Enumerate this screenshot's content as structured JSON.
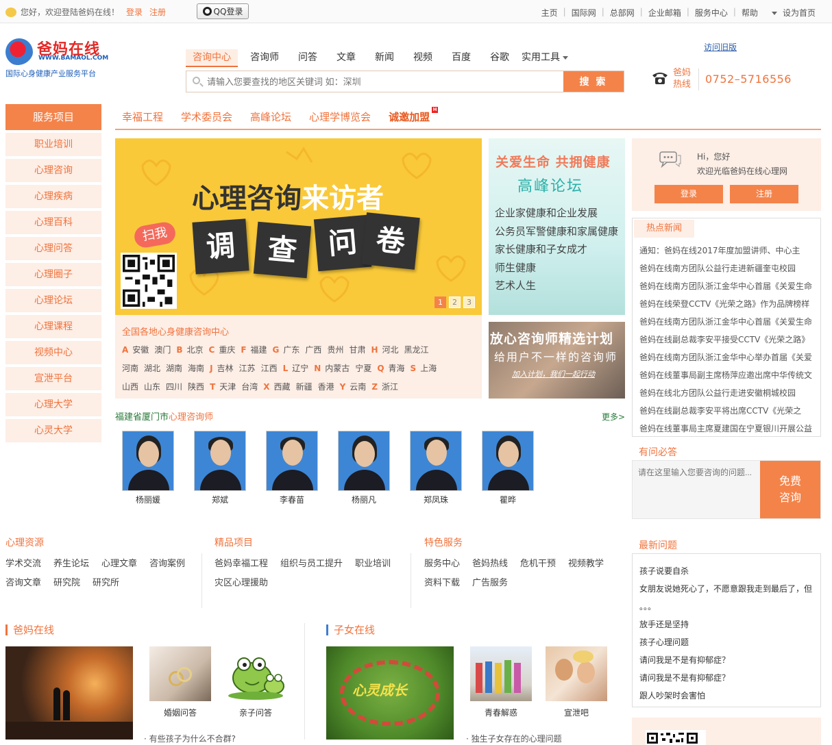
{
  "topbar": {
    "welcome": "您好，欢迎登陆爸妈在线！",
    "login": "登录",
    "register": "注册",
    "qq_login": "QQ登录",
    "links": [
      "主页",
      "国际网",
      "总部网",
      "企业邮箱",
      "服务中心",
      "帮助",
      "设为首页"
    ]
  },
  "logo": {
    "name": "爸妈在线",
    "url": "WWW.BAMAOL.COM",
    "tagline": "国际心身健康产业服务平台"
  },
  "nav_tabs": [
    "咨询中心",
    "咨询师",
    "问答",
    "文章",
    "新闻",
    "视频",
    "百度",
    "谷歌",
    "实用工具"
  ],
  "search": {
    "placeholder": "请输入您要查找的地区关键词 如：深圳",
    "button": "搜 索"
  },
  "old_version": "访问旧版",
  "hotline": {
    "label": "爸妈热线",
    "number": "0752–5716556"
  },
  "service": {
    "title": "服务项目",
    "items": [
      "职业培训",
      "心理咨询",
      "心理疾病",
      "心理百科",
      "心理问答",
      "心理圈子",
      "心理论坛",
      "心理课程",
      "视频中心",
      "宣泄平台",
      "心理大学",
      "心灵大学"
    ]
  },
  "subnav": [
    "幸福工程",
    "学术委员会",
    "高峰论坛",
    "心理学博览会",
    "诚邀加盟"
  ],
  "subnav_hot_badge": "H",
  "banner": {
    "title_a": "心理咨询",
    "title_b": "来访者",
    "cards": [
      "调",
      "查",
      "问",
      "卷"
    ],
    "scan": "扫我",
    "pages": [
      "1",
      "2",
      "3"
    ]
  },
  "forum_ad": {
    "headline": "关爱生命  共拥健康",
    "subtitle": "高峰论坛",
    "topics": [
      "企业家健康和企业发展",
      "公务员军警健康和家属健康",
      "家长健康和子女成才",
      "师生健康",
      "艺术人生"
    ]
  },
  "plan_ad": {
    "headline": "放心咨询师精选计划",
    "subtitle": "给用户不一样的咨询师",
    "footer": "加入计划，我们一起行动"
  },
  "regions": {
    "title": "全国各地心身健康咨询中心",
    "rows": [
      [
        [
          "A",
          [
            "安徽",
            "澳门"
          ]
        ],
        [
          "B",
          [
            "北京"
          ]
        ],
        [
          "C",
          [
            "重庆"
          ]
        ],
        [
          "F",
          [
            "福建"
          ]
        ],
        [
          "G",
          [
            "广东",
            "广西",
            "贵州",
            "甘肃"
          ]
        ],
        [
          "H",
          [
            "河北",
            "黑龙江"
          ]
        ]
      ],
      [
        [
          "",
          [
            "河南",
            "湖北",
            "湖南",
            "海南"
          ]
        ],
        [
          "J",
          [
            "吉林",
            "江苏",
            "江西"
          ]
        ],
        [
          "L",
          [
            "辽宁"
          ]
        ],
        [
          "N",
          [
            "内蒙古",
            "宁夏"
          ]
        ],
        [
          "Q",
          [
            "青海"
          ]
        ],
        [
          "S",
          [
            "上海"
          ]
        ]
      ],
      [
        [
          "",
          [
            "山西",
            "山东",
            "四川",
            "陕西"
          ]
        ],
        [
          "T",
          [
            "天津",
            "台湾"
          ]
        ],
        [
          "X",
          [
            "西藏",
            "新疆",
            "香港"
          ]
        ],
        [
          "Y",
          [
            "云南"
          ]
        ],
        [
          "Z",
          [
            "浙江"
          ]
        ]
      ]
    ]
  },
  "counselors": {
    "title_a": "福建省厦门市",
    "title_b": "心理咨询师",
    "more": "更多>",
    "names": [
      "杨丽媛",
      "郑斌",
      "李春苗",
      "杨丽凡",
      "郑凤珠",
      "瞿晔"
    ]
  },
  "user": {
    "hi": "Hi，您好",
    "welcome": "欢迎光临爸妈在线心理网",
    "login": "登录",
    "register": "注册"
  },
  "hot_news": {
    "tab": "热点新闻",
    "items": [
      "通知：爸妈在线2017年度加盟讲师、中心主",
      "爸妈在线南方团队公益行走进新疆奎屯校园",
      "爸妈在线南方团队浙江金华中心首届《关爱生命",
      "爸妈在线荣登CCTV《光荣之路》作为品牌榜样",
      "爸妈在线南方团队浙江金华中心首届《关爱生命",
      "爸妈在线副总裁李安平接受CCTV《光荣之路》",
      "爸妈在线南方团队浙江金华中心举办首届《关爱",
      "爸妈在线董事局副主席杨萍应邀出席中华传统文",
      "爸妈在线北方团队公益行走进安徽桐城校园",
      "爸妈在线副总裁李安平将出席CCTV《光荣之",
      "爸妈在线董事局主席夏建国在宁夏银川开展公益"
    ]
  },
  "ask": {
    "title": "有问必答",
    "placeholder": "请在这里输入您要咨询的问题...",
    "button": "免费咨询"
  },
  "latest": {
    "title": "最新问题",
    "items": [
      "孩子说要自杀",
      "女朋友说她死心了，不愿意跟我走到最后了，但",
      "。。。",
      "放手还是坚持",
      "孩子心理问题",
      "请问我是不是有抑郁症？",
      "请问我是不是有抑郁症？",
      "跟人吵架时会害怕"
    ]
  },
  "resources": [
    {
      "title": "心理资源",
      "links": [
        [
          "学术交流",
          "养生论坛",
          "心理文章",
          "咨询案例"
        ],
        [
          "咨询文章",
          "研究院",
          "研究所"
        ]
      ]
    },
    {
      "title": "精品项目",
      "links": [
        [
          "爸妈幸福工程",
          "组织与员工提升",
          "职业培训"
        ],
        [
          "灾区心理援助"
        ]
      ]
    },
    {
      "title": "特色服务",
      "links": [
        [
          "服务中心",
          "爸妈热线",
          "危机干预",
          "视频教学"
        ],
        [
          "资料下载",
          "广告服务"
        ]
      ]
    }
  ],
  "bottom": {
    "left_title": "爸妈在线",
    "left_caps": [
      "婚姻问答",
      "亲子问答"
    ],
    "left_line": "· 有些孩子为什么不合群?",
    "right_title": "子女在线",
    "right_img_text": "心灵成长",
    "right_caps": [
      "青春解惑",
      "宣泄吧"
    ],
    "right_line": "· 独生子女存在的心理问题"
  },
  "colors": {
    "accent": "#f4834a",
    "accent_text": "#f0733c",
    "light_bg": "#fdeee6",
    "banner_yellow": "#f9c93a",
    "link_blue": "#2a5ca8"
  }
}
